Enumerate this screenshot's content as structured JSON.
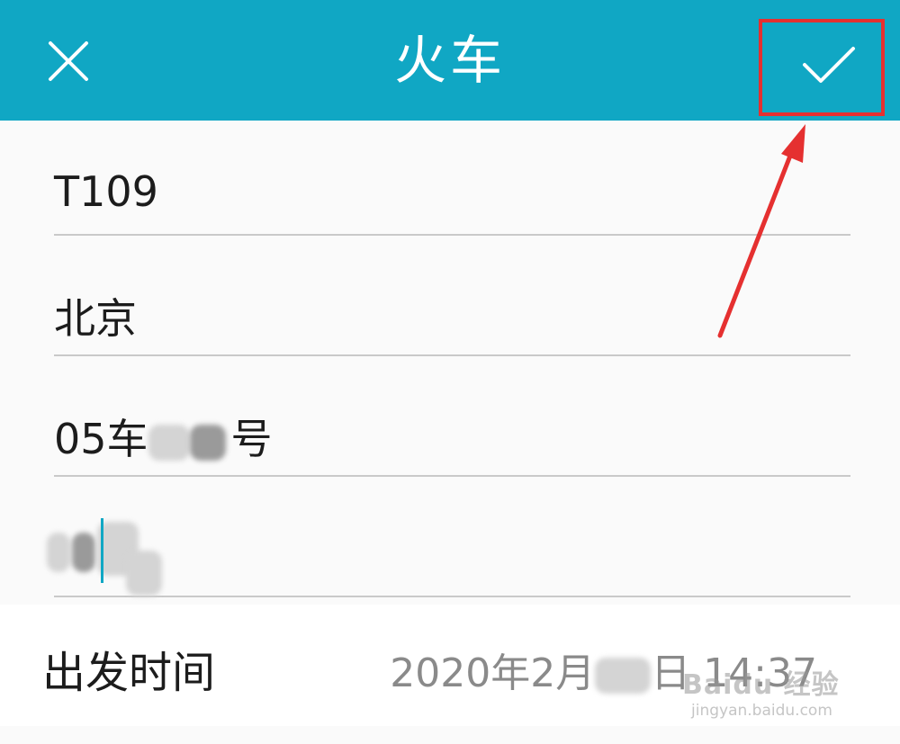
{
  "header": {
    "title": "火车",
    "close_icon": "close-icon",
    "confirm_icon": "check-icon",
    "color": "#10a7c4"
  },
  "form": {
    "train_number": "T109",
    "station": "北京",
    "seat_prefix": "05车",
    "seat_suffix": "号"
  },
  "departure": {
    "label": "出发时间",
    "value_year_month": "2020年2月",
    "value_day_time": "日 14:37"
  },
  "watermark": {
    "brand": "Baidu 经验",
    "url": "jingyan.baidu.com"
  },
  "annotation": {
    "color": "#e53030"
  }
}
